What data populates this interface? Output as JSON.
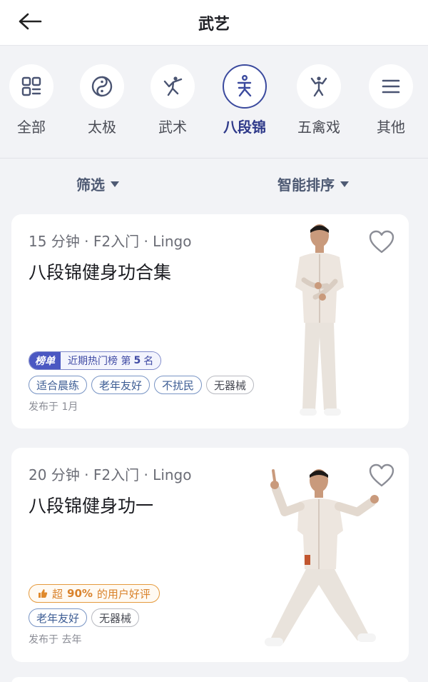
{
  "header": {
    "title": "武艺",
    "back_icon": "arrow-left-icon"
  },
  "categories": [
    {
      "label": "全部",
      "icon": "grid-icon",
      "active": false
    },
    {
      "label": "太极",
      "icon": "yin-yang-icon",
      "active": false
    },
    {
      "label": "武术",
      "icon": "martial-arts-icon",
      "active": false
    },
    {
      "label": "八段锦",
      "icon": "baduanjin-icon",
      "active": true
    },
    {
      "label": "五禽戏",
      "icon": "wuqinxi-icon",
      "active": false
    },
    {
      "label": "其他",
      "icon": "menu-icon",
      "active": false
    }
  ],
  "filters": {
    "filter_label": "筛选",
    "sort_label": "智能排序"
  },
  "cards": [
    {
      "meta": "15 分钟 · F2入门 · Lingo",
      "title": "八段锦健身功合集",
      "rank": {
        "tag": "榜单",
        "text": "近期热门榜 第",
        "num": "5",
        "suffix": "名"
      },
      "tags": [
        "适合晨练",
        "老年友好",
        "不扰民",
        "无器械"
      ],
      "published": "发布于 1月",
      "favorite_icon": "heart-outline-icon"
    },
    {
      "meta": "20 分钟 · F2入门 · Lingo",
      "title": "八段锦健身功一",
      "rating": {
        "prefix": "超",
        "percent": "90%",
        "text": "的用户好评",
        "icon": "thumbs-up-icon"
      },
      "tags": [
        "老年友好",
        "无器械"
      ],
      "published": "发布于 去年",
      "favorite_icon": "heart-outline-icon"
    }
  ],
  "colors": {
    "accent": "#3b4a9e",
    "tag_blue": "#3d5d94",
    "badge_orange": "#d9822b"
  }
}
